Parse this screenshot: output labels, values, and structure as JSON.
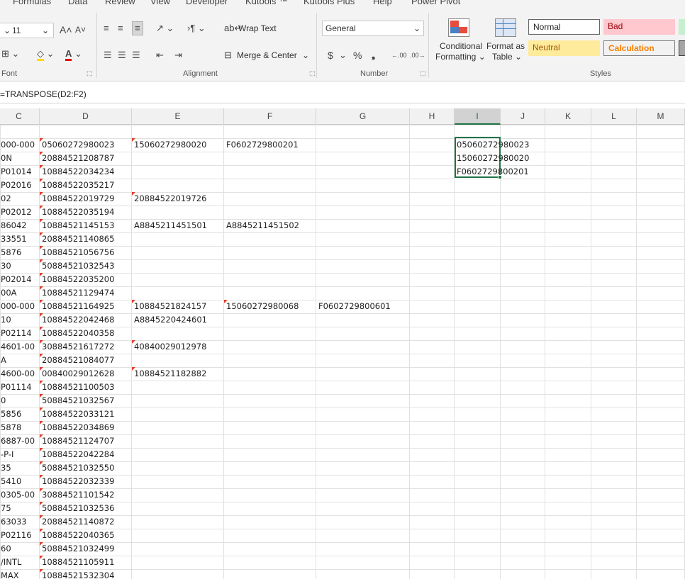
{
  "ribbon_tabs": [
    "Formulas",
    "Data",
    "Review",
    "View",
    "Developer",
    "Kutools ™",
    "Kutools Plus",
    "Help",
    "Power Pivot"
  ],
  "font": {
    "size": "11",
    "grow_icon": "A˄",
    "shrink_icon": "A˅",
    "group_label": "Font"
  },
  "alignment": {
    "wrap_text": "Wrap Text",
    "merge_center": "Merge & Center",
    "group_label": "Alignment"
  },
  "number": {
    "format": "General",
    "currency": "$",
    "percent": "%",
    "comma": "❟",
    "increase_decimal": ".00",
    "decrease_decimal": ".00",
    "group_label": "Number"
  },
  "styles": {
    "conditional_formatting": "Conditional",
    "conditional_formatting_2": "Formatting",
    "format_as_table": "Format as",
    "format_as_table_2": "Table",
    "group_label": "Styles",
    "cells": [
      {
        "label": "Normal",
        "bg": "#ffffff",
        "color": "#000000"
      },
      {
        "label": "Bad",
        "bg": "#ffc7ce",
        "color": "#9c0006"
      },
      {
        "label": "Neutral",
        "bg": "#ffeb9c",
        "color": "#9c5700"
      },
      {
        "label": "Calculation",
        "bg": "#f2f2f2",
        "color": "#fa7d00"
      }
    ]
  },
  "formula_bar": {
    "formula": "=TRANSPOSE(D2:F2)"
  },
  "columns": [
    "C",
    "D",
    "E",
    "F",
    "G",
    "H",
    "I",
    "J",
    "K",
    "L",
    "M"
  ],
  "active_column": "I",
  "rows": [
    {
      "C": "",
      "D": "",
      "E": "",
      "F": "",
      "G": "",
      "flagD": false,
      "flagE": false,
      "flagF": false
    },
    {
      "C": "000-000",
      "D": "05060272980023",
      "E": "15060272980020",
      "F": "F0602729800201",
      "G": "",
      "flagD": true,
      "flagE": true,
      "flagF": false
    },
    {
      "C": "0N",
      "D": "20884521208787",
      "E": "",
      "F": "",
      "G": "",
      "flagD": true,
      "flagE": false,
      "flagF": false
    },
    {
      "C": "P01014",
      "D": "10884522034234",
      "E": "",
      "F": "",
      "G": "",
      "flagD": true,
      "flagE": false,
      "flagF": false
    },
    {
      "C": "P02016",
      "D": "10884522035217",
      "E": "",
      "F": "",
      "G": "",
      "flagD": true,
      "flagE": false,
      "flagF": false
    },
    {
      "C": "02",
      "D": "10884522019729",
      "E": "20884522019726",
      "F": "",
      "G": "",
      "flagD": true,
      "flagE": true,
      "flagF": false
    },
    {
      "C": "P02012",
      "D": "10884522035194",
      "E": "",
      "F": "",
      "G": "",
      "flagD": true,
      "flagE": false,
      "flagF": false
    },
    {
      "C": "86042",
      "D": "10884521145153",
      "E": "A8845211451501",
      "F": "A8845211451502",
      "G": "",
      "flagD": true,
      "flagE": false,
      "flagF": false
    },
    {
      "C": "33551",
      "D": "20884521140865",
      "E": "",
      "F": "",
      "G": "",
      "flagD": true,
      "flagE": false,
      "flagF": false
    },
    {
      "C": "5876",
      "D": "10884521056756",
      "E": "",
      "F": "",
      "G": "",
      "flagD": true,
      "flagE": false,
      "flagF": false
    },
    {
      "C": "30",
      "D": "50884521032543",
      "E": "",
      "F": "",
      "G": "",
      "flagD": true,
      "flagE": false,
      "flagF": false
    },
    {
      "C": "P02014",
      "D": "10884522035200",
      "E": "",
      "F": "",
      "G": "",
      "flagD": true,
      "flagE": false,
      "flagF": false
    },
    {
      "C": "00A",
      "D": "10884521129474",
      "E": "",
      "F": "",
      "G": "",
      "flagD": true,
      "flagE": false,
      "flagF": false
    },
    {
      "C": "000-000",
      "D": "10884521164925",
      "E": "10884521824157",
      "F": "15060272980068",
      "G": "F0602729800601",
      "flagD": true,
      "flagE": true,
      "flagF": true
    },
    {
      "C": "10",
      "D": "10884522042468",
      "E": "A8845220424601",
      "F": "",
      "G": "",
      "flagD": true,
      "flagE": false,
      "flagF": false
    },
    {
      "C": "P02114",
      "D": "10884522040358",
      "E": "",
      "F": "",
      "G": "",
      "flagD": true,
      "flagE": false,
      "flagF": false
    },
    {
      "C": "4601-00",
      "D": "30884521617272",
      "E": "40840029012978",
      "F": "",
      "G": "",
      "flagD": true,
      "flagE": true,
      "flagF": false
    },
    {
      "C": "A",
      "D": "20884521084077",
      "E": "",
      "F": "",
      "G": "",
      "flagD": true,
      "flagE": false,
      "flagF": false
    },
    {
      "C": "4600-00",
      "D": "00840029012628",
      "E": "10884521182882",
      "F": "",
      "G": "",
      "flagD": true,
      "flagE": true,
      "flagF": false
    },
    {
      "C": "P01114",
      "D": "10884521100503",
      "E": "",
      "F": "",
      "G": "",
      "flagD": true,
      "flagE": false,
      "flagF": false
    },
    {
      "C": "0",
      "D": "50884521032567",
      "E": "",
      "F": "",
      "G": "",
      "flagD": true,
      "flagE": false,
      "flagF": false
    },
    {
      "C": "5856",
      "D": "10884522033121",
      "E": "",
      "F": "",
      "G": "",
      "flagD": true,
      "flagE": false,
      "flagF": false
    },
    {
      "C": "5878",
      "D": "10884522034869",
      "E": "",
      "F": "",
      "G": "",
      "flagD": true,
      "flagE": false,
      "flagF": false
    },
    {
      "C": "6887-00",
      "D": "10884521124707",
      "E": "",
      "F": "",
      "G": "",
      "flagD": true,
      "flagE": false,
      "flagF": false
    },
    {
      "C": "-P-I",
      "D": "10884522042284",
      "E": "",
      "F": "",
      "G": "",
      "flagD": true,
      "flagE": false,
      "flagF": false
    },
    {
      "C": "35",
      "D": "50884521032550",
      "E": "",
      "F": "",
      "G": "",
      "flagD": true,
      "flagE": false,
      "flagF": false
    },
    {
      "C": "5410",
      "D": "10884522032339",
      "E": "",
      "F": "",
      "G": "",
      "flagD": true,
      "flagE": false,
      "flagF": false
    },
    {
      "C": "0305-00",
      "D": "30884521101542",
      "E": "",
      "F": "",
      "G": "",
      "flagD": true,
      "flagE": false,
      "flagF": false
    },
    {
      "C": "75",
      "D": "50884521032536",
      "E": "",
      "F": "",
      "G": "",
      "flagD": true,
      "flagE": false,
      "flagF": false
    },
    {
      "C": "63033",
      "D": "20884521140872",
      "E": "",
      "F": "",
      "G": "",
      "flagD": true,
      "flagE": false,
      "flagF": false
    },
    {
      "C": "P02116",
      "D": "10884522040365",
      "E": "",
      "F": "",
      "G": "",
      "flagD": true,
      "flagE": false,
      "flagF": false
    },
    {
      "C": "60",
      "D": "50884521032499",
      "E": "",
      "F": "",
      "G": "",
      "flagD": true,
      "flagE": false,
      "flagF": false
    },
    {
      "C": "/INTL",
      "D": "10884521105911",
      "E": "",
      "F": "",
      "G": "",
      "flagD": true,
      "flagE": false,
      "flagF": false
    },
    {
      "C": "MAX",
      "D": "10884521532304",
      "E": "",
      "F": "",
      "G": "",
      "flagD": true,
      "flagE": false,
      "flagF": false
    }
  ],
  "transposed": [
    "05060272980023",
    "15060272980020",
    "F0602729800201"
  ]
}
